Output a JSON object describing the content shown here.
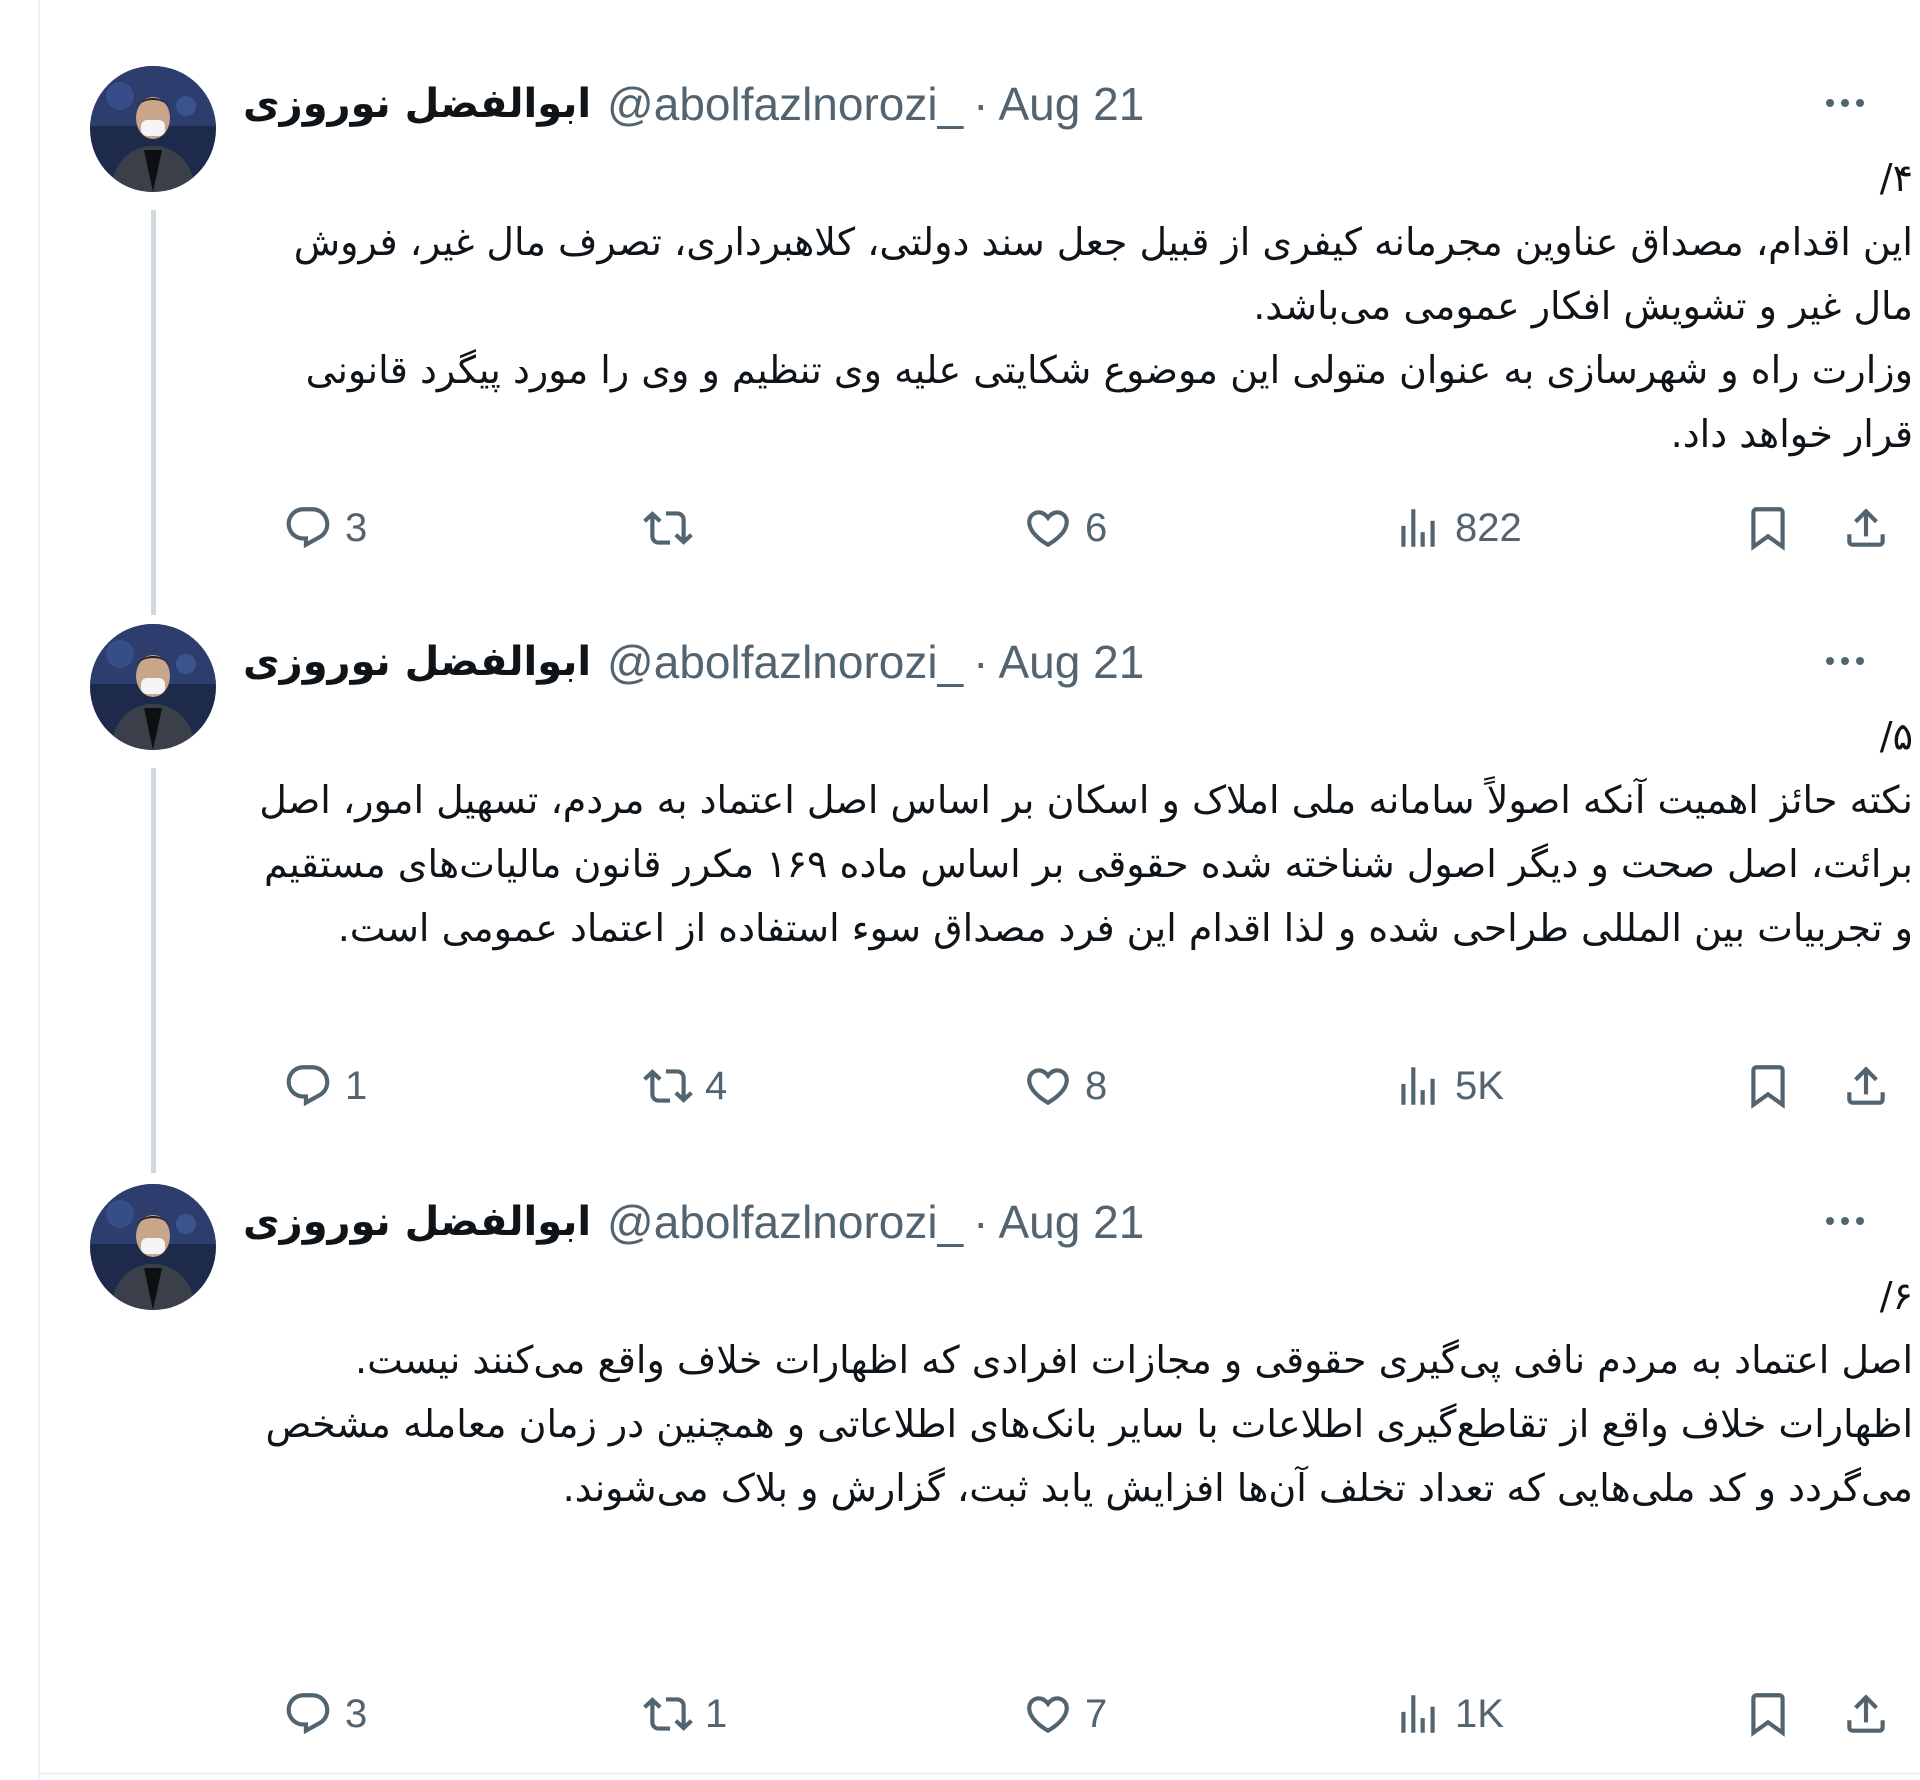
{
  "tweets": [
    {
      "author_name": "ابوالفضل نوروزی",
      "handle": "@abolfazlnorozi_",
      "separator": "·",
      "date": "Aug 21",
      "text": "۴/\nاین اقدام، مصداق عناوین مجرمانه کیفری از قبیل جعل سند دولتی، کلاهبرداری، تصرف مال غیر، فروش مال غیر و تشویش افکار عمومی می‌باشد.\nوزارت راه و شهرسازی به عنوان متولی این موضوع شکایتی علیه وی تنظیم و وی را مورد پیگرد قانونی قرار خواهد داد.",
      "replies": "3",
      "retweets": "",
      "likes": "6",
      "views": "822"
    },
    {
      "author_name": "ابوالفضل نوروزی",
      "handle": "@abolfazlnorozi_",
      "separator": "·",
      "date": "Aug 21",
      "text": "۵/\nنکته حائز اهمیت آنکه اصولاً سامانه ملی املاک و اسکان بر اساس اصل اعتماد به مردم، تسهیل امور، اصل برائت، اصل صحت و دیگر اصول شناخته شده حقوقی بر اساس ماده ۱۶۹ مکرر قانون مالیات‌های مستقیم و تجربیات بین المللی طراحی شده و لذا اقدام این فرد مصداق سوء استفاده از اعتماد عمومی است.",
      "replies": "1",
      "retweets": "4",
      "likes": "8",
      "views": "5K"
    },
    {
      "author_name": "ابوالفضل نوروزی",
      "handle": "@abolfazlnorozi_",
      "separator": "·",
      "date": "Aug 21",
      "text": "۶/\nاصل اعتماد به مردم نافی پی‌گیری حقوقی و مجازات افرادی که اظهارات خلاف واقع می‌کنند نیست.\nاظهارات خلاف واقع از تقاطع‌گیری اطلاعات با سایر بانک‌های اطلاعاتی و همچنین در زمان معامله مشخص می‌گردد و کد ملی‌هایی که تعداد تخلف آن‌ها افزایش یابد ثبت، گزارش و بلاک می‌شوند.",
      "replies": "3",
      "retweets": "1",
      "likes": "7",
      "views": "1K"
    }
  ],
  "icons": {
    "avatar": "avatar-photo",
    "more": "more-icon",
    "reply": "reply-icon",
    "retweet": "retweet-icon",
    "like": "heart-icon",
    "views": "views-icon",
    "bookmark": "bookmark-icon",
    "share": "share-icon"
  },
  "colors": {
    "text": "#0f1419",
    "secondary": "#536471",
    "thread_line": "#cfd9de",
    "border": "#eff3f4"
  }
}
